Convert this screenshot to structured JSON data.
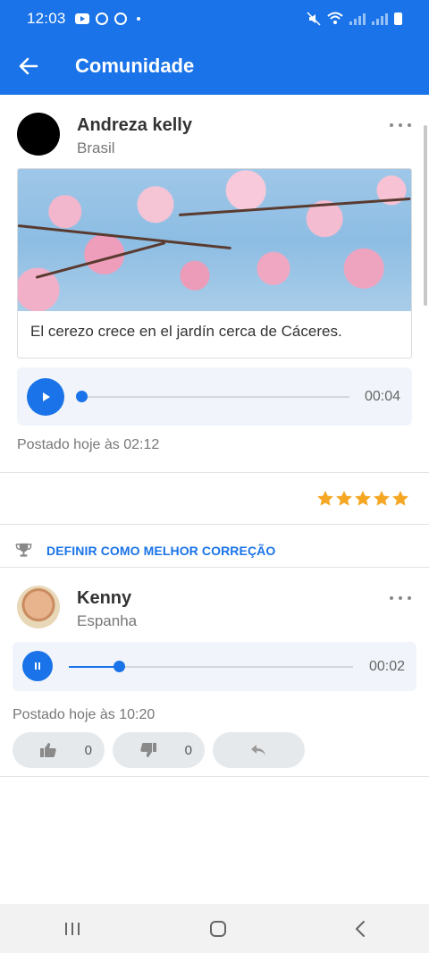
{
  "status_bar": {
    "time": "12:03"
  },
  "app_bar": {
    "title": "Comunidade"
  },
  "post": {
    "author": "Andreza kelly",
    "country": "Brasil",
    "caption": "El cerezo crece en el jardín cerca de Cáceres.",
    "audio": {
      "duration": "00:04",
      "progress": 0.0
    },
    "posted": "Postado hoje às 02:12",
    "rating": 5
  },
  "best_correction": {
    "label": "DEFINIR COMO MELHOR CORREÇÃO"
  },
  "reply": {
    "author": "Kenny",
    "country": "Espanha",
    "audio": {
      "duration": "00:02",
      "progress": 0.17,
      "state": "playing"
    },
    "posted": "Postado hoje às 10:20",
    "likes": "0",
    "dislikes": "0"
  },
  "colors": {
    "primary": "#1a73e8",
    "star": "#f5a623"
  }
}
